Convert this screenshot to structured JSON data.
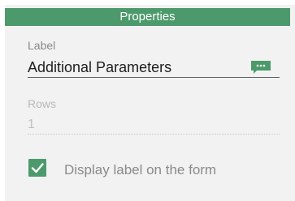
{
  "panel": {
    "title": "Properties"
  },
  "label_field": {
    "caption": "Label",
    "value": "Additional Parameters",
    "icon": "comment-ellipsis-icon"
  },
  "rows_field": {
    "caption": "Rows",
    "value": "1"
  },
  "display_label": {
    "checked": true,
    "text": "Display label on the form",
    "icon": "checkmark-icon"
  },
  "colors": {
    "accent": "#4c9a6c",
    "panel_background": "#f2f2f2"
  }
}
